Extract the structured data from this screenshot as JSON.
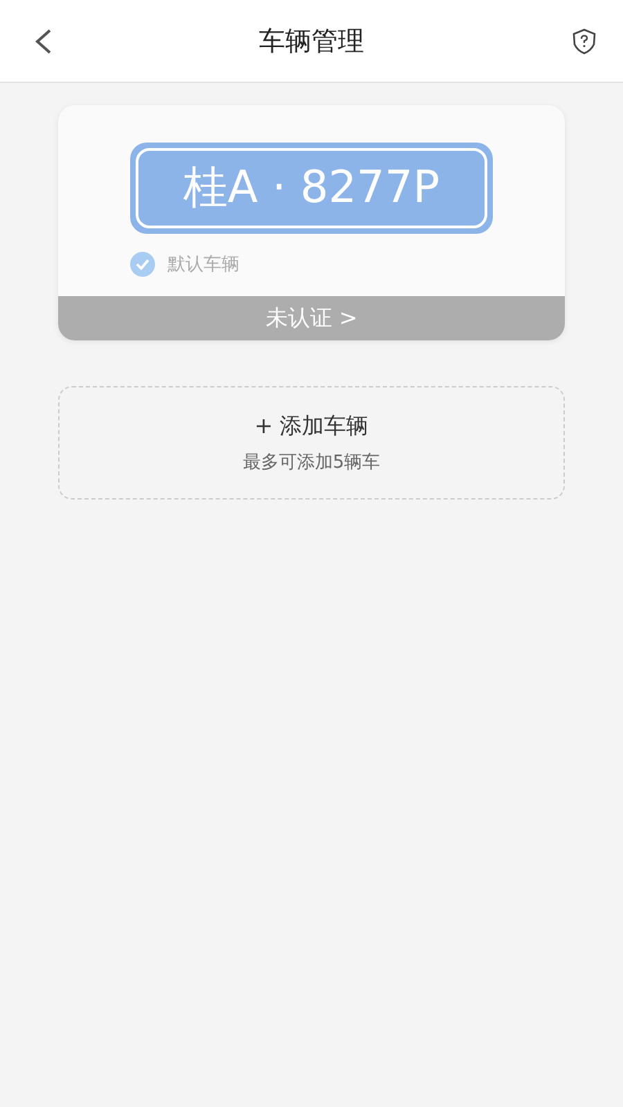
{
  "header": {
    "title": "车辆管理"
  },
  "vehicles": [
    {
      "plate": "桂A · 8277P",
      "default_label": "默认车辆",
      "default": true,
      "status": "未认证 >"
    }
  ],
  "add": {
    "label": "+ 添加车辆",
    "hint": "最多可添加5辆车"
  }
}
